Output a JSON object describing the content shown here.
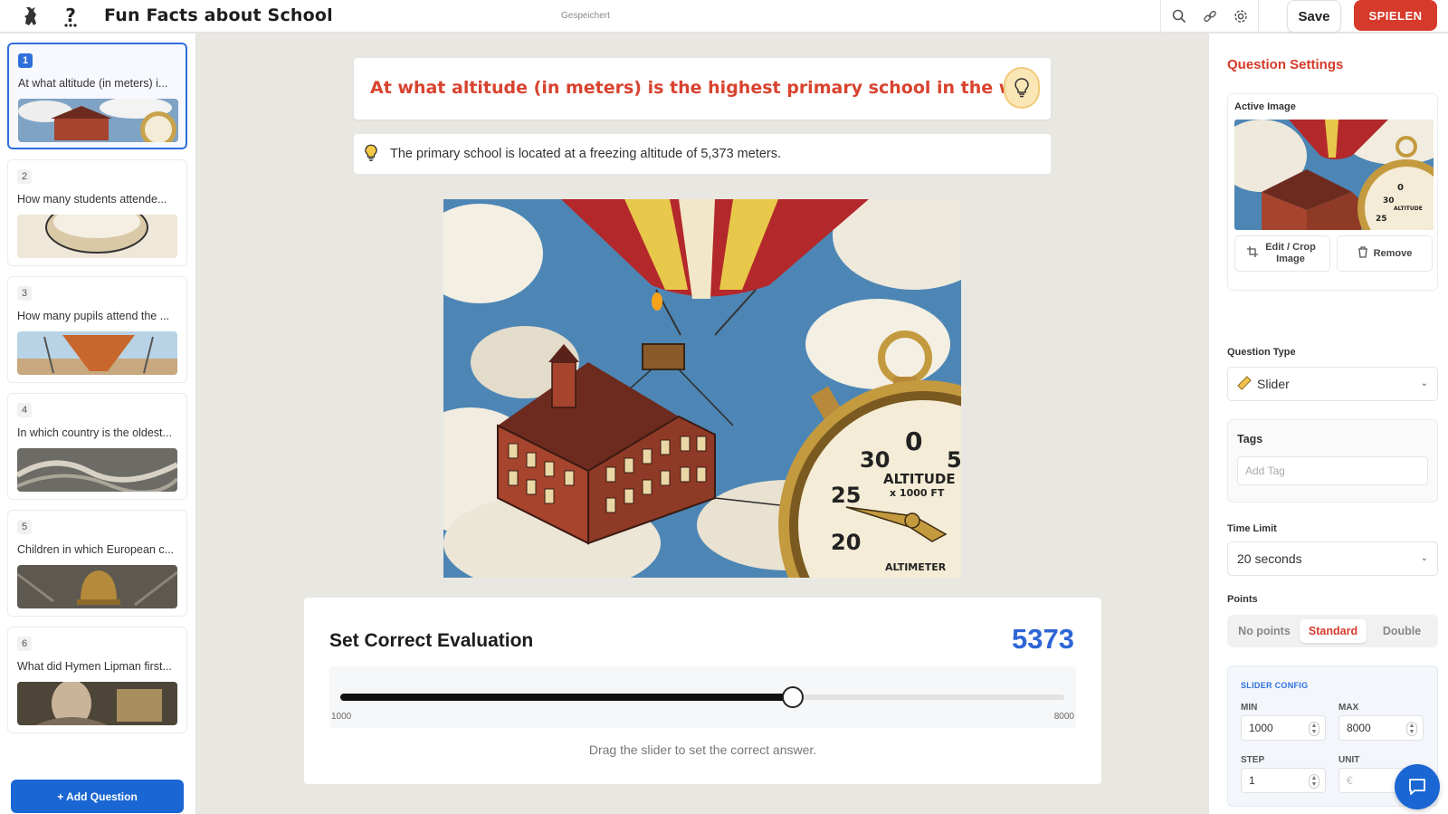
{
  "header": {
    "title": "Fun Facts about School",
    "status": "Gespeichert",
    "save_label": "Save",
    "play_label": "SPIELEN",
    "brand_color": "#d63a2a"
  },
  "sidebar": {
    "questions": [
      {
        "number": "1",
        "text": "At what altitude (in meters) i..."
      },
      {
        "number": "2",
        "text": "How many students attende..."
      },
      {
        "number": "3",
        "text": "How many pupils attend the ..."
      },
      {
        "number": "4",
        "text": "In which country is the oldest..."
      },
      {
        "number": "5",
        "text": "Children in which European c..."
      },
      {
        "number": "6",
        "text": "What did Hymen Lipman first..."
      }
    ],
    "add_question_label": "+ Add Question"
  },
  "main": {
    "question": "At what altitude (in meters) is the highest primary school in the world (",
    "explanation": "The primary school is located at a freezing altitude of 5,373 meters.",
    "image_labels": {
      "gauge_0": "0",
      "gauge_30": "30",
      "gauge_5": "5",
      "gauge_25": "25",
      "gauge_20": "20",
      "gauge_title": "ALTITUDE",
      "gauge_sub": "x 1000 FT",
      "gauge_bottom": "ALTIMETER"
    },
    "evaluation": {
      "title": "Set Correct Evaluation",
      "value": "5373",
      "min_label": "1000",
      "max_label": "8000",
      "fraction": 0.6247,
      "help": "Drag the slider to set the correct answer."
    }
  },
  "settings": {
    "title": "Question Settings",
    "active_image_label": "Active Image",
    "edit_crop_label": "Edit / Crop Image",
    "remove_label": "Remove",
    "question_type_label": "Question Type",
    "question_type_value": "Slider",
    "tags_label": "Tags",
    "tags_placeholder": "Add Tag",
    "time_limit_label": "Time Limit",
    "time_limit_value": "20 seconds",
    "points_label": "Points",
    "points_options": [
      "No points",
      "Standard",
      "Double"
    ],
    "points_selected": "Standard",
    "slider_config": {
      "heading": "SLIDER CONFIG",
      "min_label": "MIN",
      "min_value": "1000",
      "max_label": "MAX",
      "max_value": "8000",
      "step_label": "STEP",
      "step_value": "1",
      "unit_label": "UNIT",
      "unit_placeholder": "€"
    }
  }
}
